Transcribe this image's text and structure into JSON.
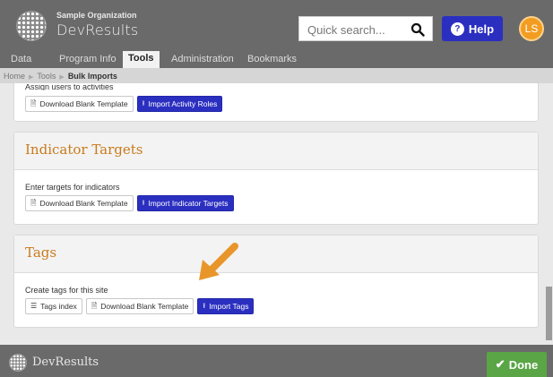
{
  "header": {
    "org_name": "Sample Organization",
    "app_name": "DevResults",
    "search_placeholder": "Quick search...",
    "help_label": "Help",
    "avatar_initials": "LS"
  },
  "nav": {
    "items": [
      "Data",
      "Program Info",
      "Tools",
      "Administration",
      "Bookmarks"
    ],
    "active": "Tools"
  },
  "breadcrumb": {
    "items": [
      "Home",
      "Tools",
      "Bulk Imports"
    ]
  },
  "panels": {
    "activity_roles": {
      "description": "Assign users to activities",
      "download_label": "Download Blank Template",
      "import_label": "Import Activity Roles"
    },
    "indicator_targets": {
      "title": "Indicator Targets",
      "description": "Enter targets for indicators",
      "download_label": "Download Blank Template",
      "import_label": "Import Indicator Targets"
    },
    "tags": {
      "title": "Tags",
      "description": "Create tags for this site",
      "index_label": "Tags index",
      "download_label": "Download Blank Template",
      "import_label": "Import Tags"
    }
  },
  "footer": {
    "brand": "DevResults",
    "done_label": "Done"
  },
  "colors": {
    "header_bg": "#6a6a6a",
    "accent_blue": "#2b2fc0",
    "panel_title": "#c97a1b",
    "avatar": "#f29d22",
    "done_green": "#5aa545",
    "arrow": "#e8962a"
  },
  "icons": {
    "search": "search-icon",
    "help": "question-circle-icon",
    "download": "file-icon",
    "import": "upload-icon",
    "list": "list-icon",
    "done": "check-icon",
    "arrow": "arrow-annotation"
  }
}
